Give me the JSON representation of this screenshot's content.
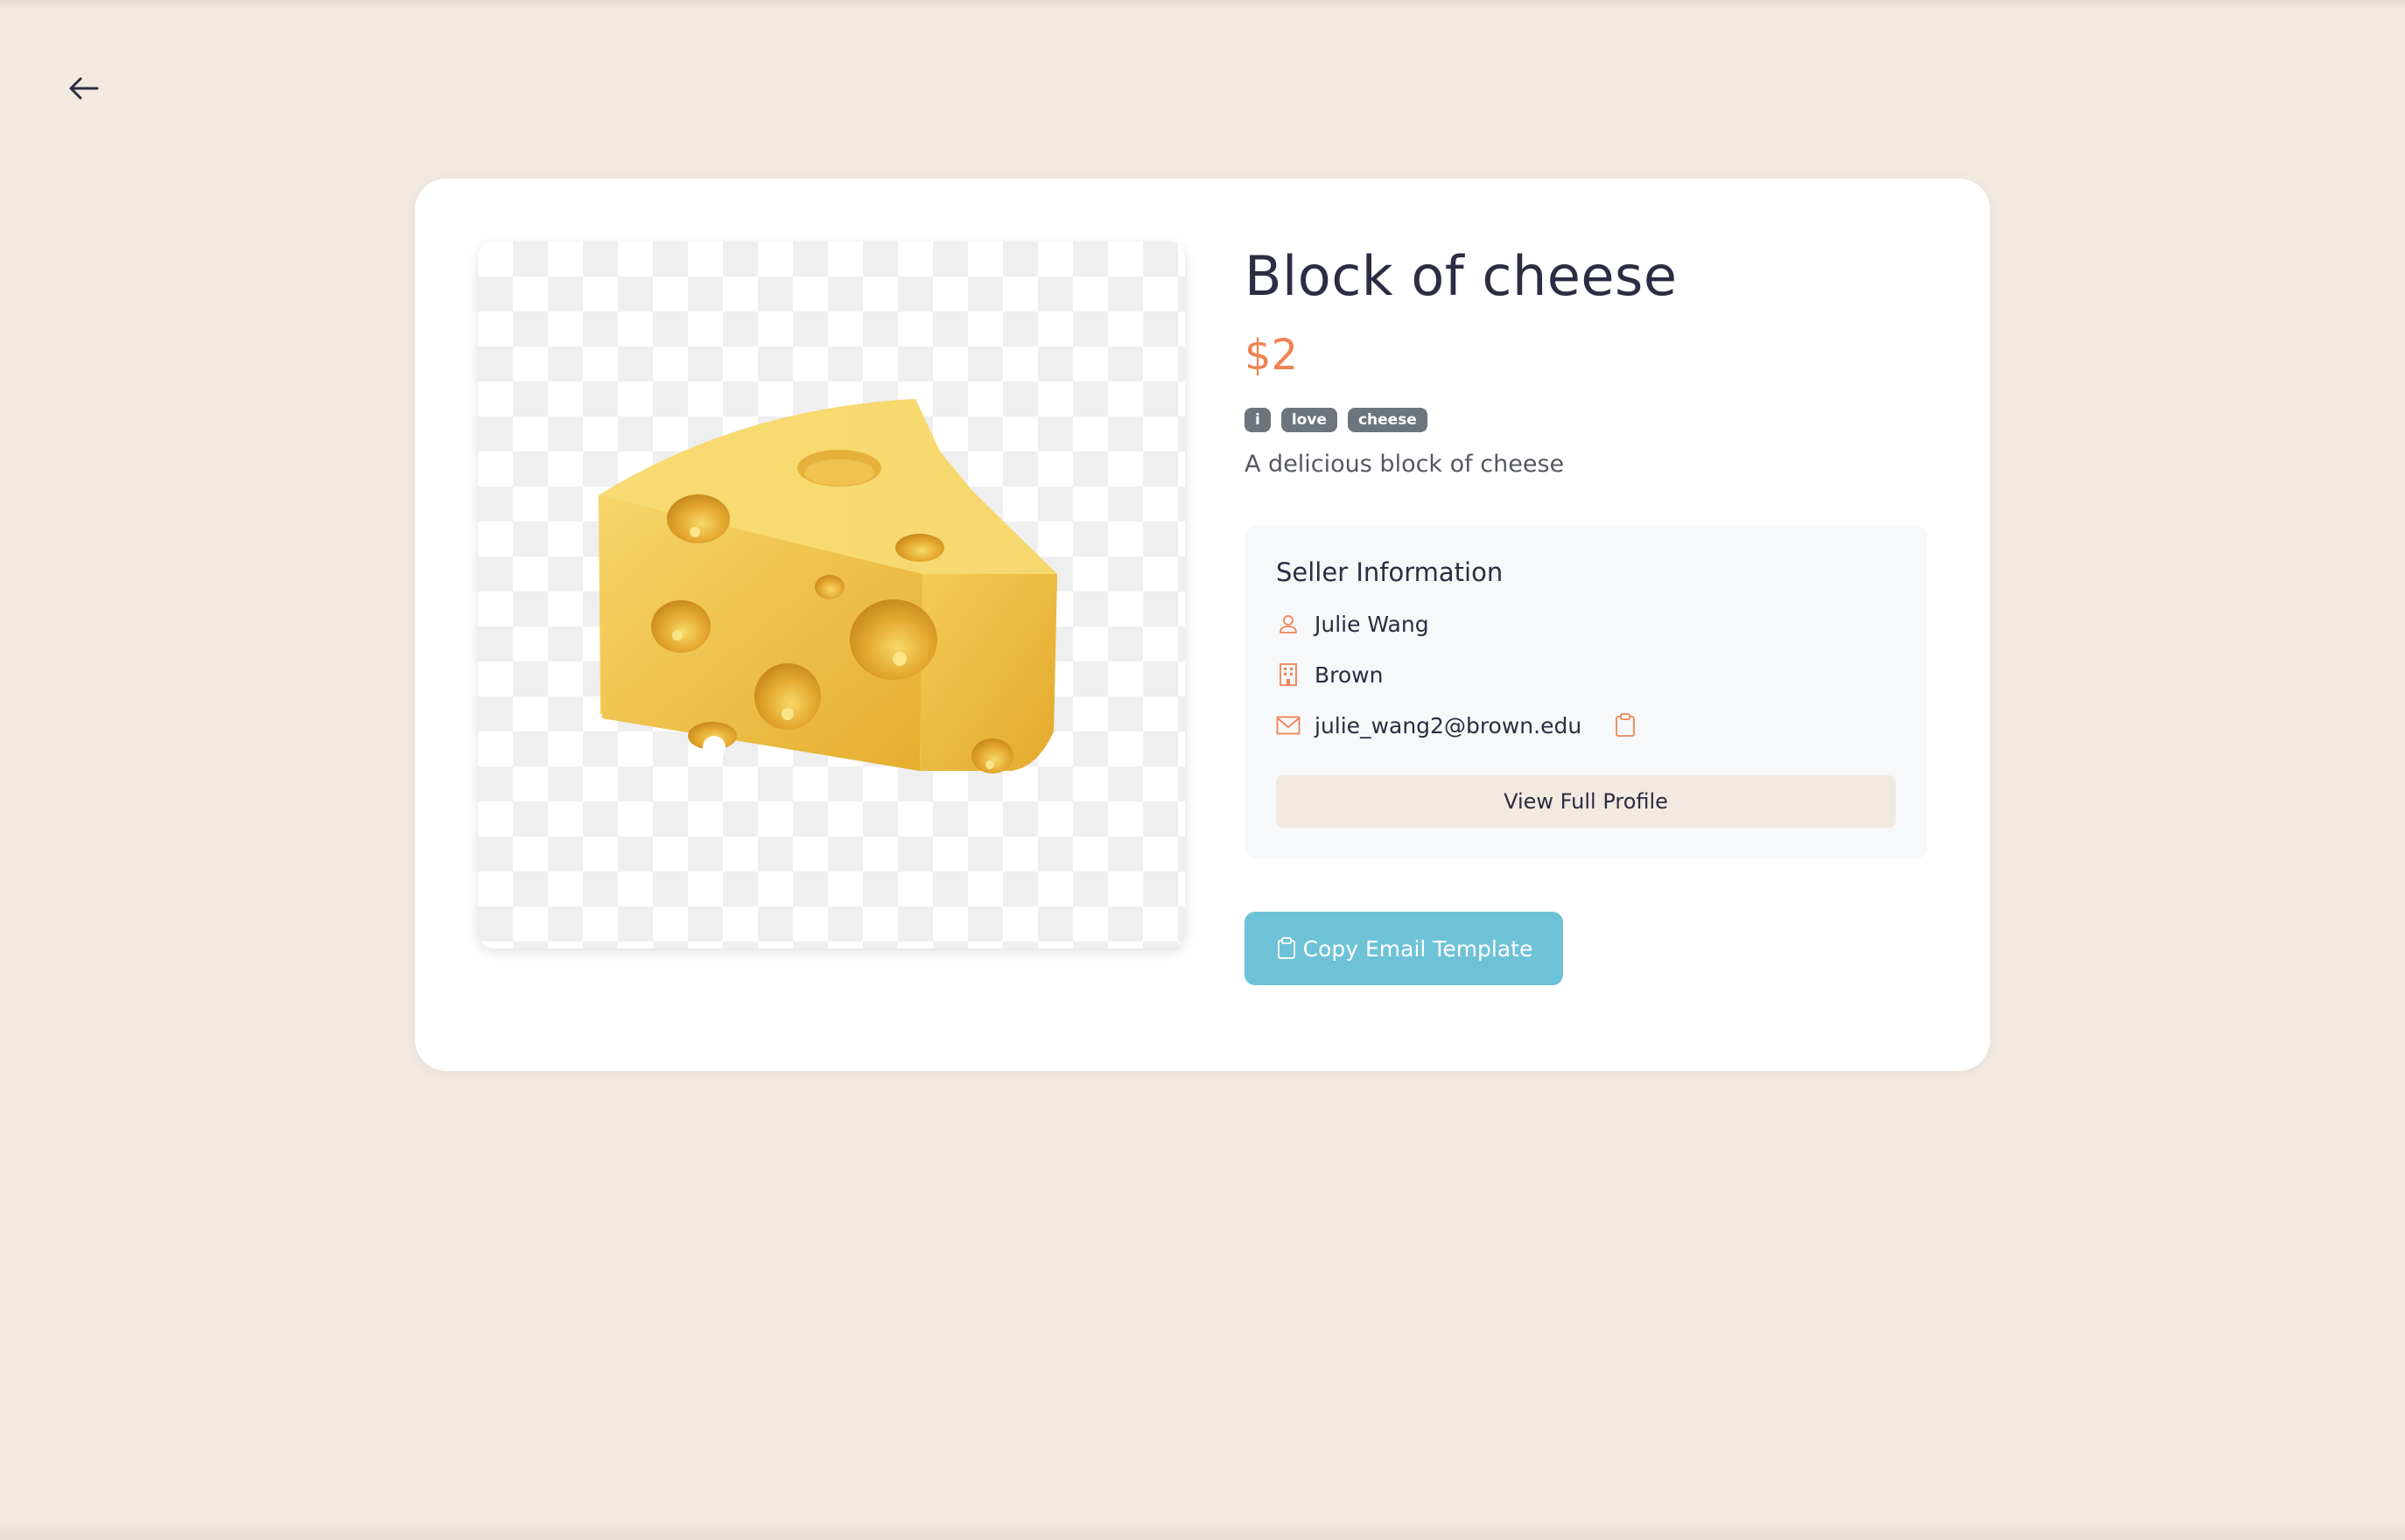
{
  "nav": {
    "back_icon": "arrow-left-icon"
  },
  "listing": {
    "image_icon": "cheese-wedge-image",
    "title": "Block of cheese",
    "price": "$2",
    "tags": [
      "i",
      "love",
      "cheese"
    ],
    "description": "A delicious block of cheese"
  },
  "seller": {
    "heading": "Seller Information",
    "name": "Julie Wang",
    "school": "Brown",
    "email": "julie_wang2@brown.edu",
    "name_icon": "user-icon",
    "school_icon": "building-icon",
    "email_icon": "envelope-icon",
    "copy_icon": "clipboard-icon",
    "profile_button_label": "View Full Profile"
  },
  "actions": {
    "copy_email_template_label": "Copy Email Template",
    "copy_email_template_icon": "clipboard-icon"
  },
  "colors": {
    "page_background": "#f2e9e0",
    "card_background": "#ffffff",
    "title_text": "#2b2d42",
    "price_accent": "#ef8354",
    "tag_background": "#6c757d",
    "seller_box_background": "#f7f8fa",
    "profile_button_background": "#f2e9e0",
    "primary_button": "#6ec2d8",
    "icon_accent": "#ef8354"
  }
}
